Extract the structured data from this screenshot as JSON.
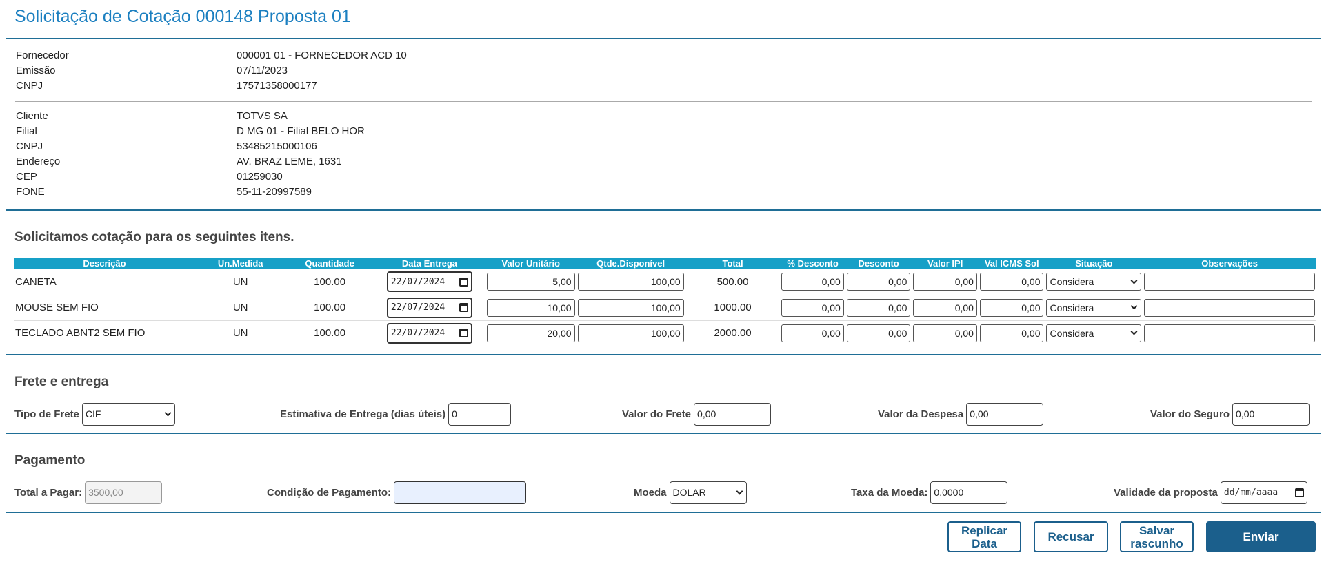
{
  "page_title": "Solicitação de Cotação 000148 Proposta 01",
  "supplier": [
    {
      "label": "Fornecedor",
      "value": "000001 01 - FORNECEDOR ACD 10"
    },
    {
      "label": "Emissão",
      "value": "07/11/2023"
    },
    {
      "label": "CNPJ",
      "value": "17571358000177"
    }
  ],
  "client": [
    {
      "label": "Cliente",
      "value": "TOTVS SA"
    },
    {
      "label": "Filial",
      "value": "D MG 01 - Filial BELO HOR"
    },
    {
      "label": "CNPJ",
      "value": "53485215000106"
    },
    {
      "label": "Endereço",
      "value": "AV. BRAZ LEME, 1631"
    },
    {
      "label": "CEP",
      "value": "01259030"
    },
    {
      "label": "FONE",
      "value": "55-11-20997589"
    }
  ],
  "items_section_title": "Solicitamos cotação para os seguintes itens.",
  "items_table": {
    "headers": [
      "Descrição",
      "Un.Medida",
      "Quantidade",
      "Data Entrega",
      "Valor Unitário",
      "Qtde.Disponível",
      "Total",
      "% Desconto",
      "Desconto",
      "Valor IPI",
      "Val ICMS Sol",
      "Situação",
      "Observações"
    ],
    "rows": [
      {
        "descricao": "CANETA",
        "un": "UN",
        "quantidade": "100.00",
        "data_entrega": "22/07/2024",
        "valor_unitario": "5,00",
        "qtde_disponivel": "100,00",
        "total": "500.00",
        "pct_desconto": "0,00",
        "desconto": "0,00",
        "valor_ipi": "0,00",
        "icms_sol": "0,00",
        "situacao": "Considera",
        "observacoes": ""
      },
      {
        "descricao": "MOUSE SEM FIO",
        "un": "UN",
        "quantidade": "100.00",
        "data_entrega": "22/07/2024",
        "valor_unitario": "10,00",
        "qtde_disponivel": "100,00",
        "total": "1000.00",
        "pct_desconto": "0,00",
        "desconto": "0,00",
        "valor_ipi": "0,00",
        "icms_sol": "0,00",
        "situacao": "Considera",
        "observacoes": ""
      },
      {
        "descricao": "TECLADO ABNT2 SEM FIO",
        "un": "UN",
        "quantidade": "100.00",
        "data_entrega": "22/07/2024",
        "valor_unitario": "20,00",
        "qtde_disponivel": "100,00",
        "total": "2000.00",
        "pct_desconto": "0,00",
        "desconto": "0,00",
        "valor_ipi": "0,00",
        "icms_sol": "0,00",
        "situacao": "Considera",
        "observacoes": ""
      }
    ]
  },
  "freight": {
    "section_title": "Frete e entrega",
    "tipo_frete_label": "Tipo de Frete",
    "tipo_frete_value": "CIF",
    "estimativa_label": "Estimativa de Entrega (dias úteis)",
    "estimativa_value": "0",
    "valor_frete_label": "Valor do Frete",
    "valor_frete_value": "0,00",
    "valor_despesa_label": "Valor da Despesa",
    "valor_despesa_value": "0,00",
    "valor_seguro_label": "Valor do Seguro",
    "valor_seguro_value": "0,00"
  },
  "payment": {
    "section_title": "Pagamento",
    "total_label": "Total a Pagar:",
    "total_value": "3500,00",
    "condicao_label": "Condição de Pagamento:",
    "condicao_value": "",
    "moeda_label": "Moeda",
    "moeda_value": "DOLAR",
    "taxa_label": "Taxa da Moeda:",
    "taxa_value": "0,0000",
    "validade_label": "Validade da proposta",
    "validade_placeholder": "dd/mm/aaaa"
  },
  "actions": {
    "replicar_line1": "Replicar",
    "replicar_line2": "Data",
    "recusar": "Recusar",
    "salvar_line1": "Salvar",
    "salvar_line2": "rascunho",
    "enviar": "Enviar"
  },
  "colors": {
    "title": "#1b7fc0",
    "table_header": "#17a0c7",
    "divider": "#1f6e96",
    "button_primary": "#1b5f8c"
  }
}
